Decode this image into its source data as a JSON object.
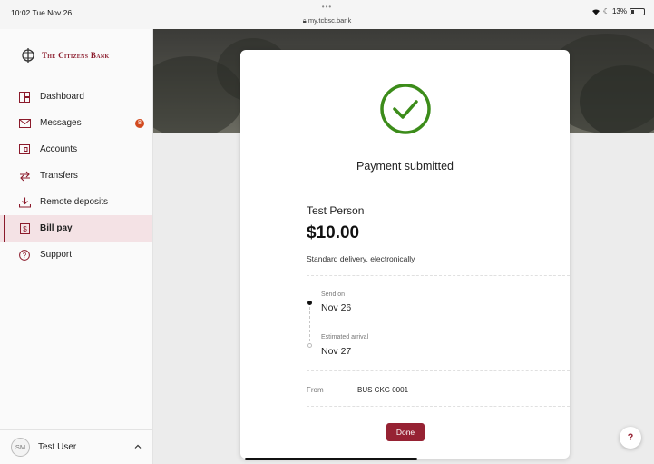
{
  "status_bar": {
    "time": "10:02  Tue Nov 26",
    "dots": "•••",
    "url": "my.tcbsc.bank",
    "battery": "13%"
  },
  "brand": {
    "name": "The Citizens Bank",
    "color": "#8b1a2b"
  },
  "nav": {
    "items": [
      {
        "label": "Dashboard",
        "icon": "dashboard-icon"
      },
      {
        "label": "Messages",
        "icon": "envelope-icon",
        "badge": "8"
      },
      {
        "label": "Accounts",
        "icon": "accounts-icon"
      },
      {
        "label": "Transfers",
        "icon": "transfer-arrows-icon"
      },
      {
        "label": "Remote deposits",
        "icon": "download-tray-icon"
      },
      {
        "label": "Bill pay",
        "icon": "bill-icon",
        "active": true
      },
      {
        "label": "Support",
        "icon": "help-circle-icon"
      }
    ]
  },
  "user": {
    "initials": "SM",
    "name": "Test User"
  },
  "confirmation": {
    "title": "Payment submitted",
    "payee": "Test Person",
    "amount": "$10.00",
    "delivery": "Standard delivery, electronically",
    "send_on_label": "Send on",
    "send_on_date": "Nov 26",
    "arrival_label": "Estimated arrival",
    "arrival_date": "Nov 27",
    "from_label": "From",
    "from_account": "BUS CKG 0001",
    "done_label": "Done",
    "success_color": "#3c8c1a",
    "button_color": "#962233"
  },
  "help_button": {
    "label": "?"
  }
}
